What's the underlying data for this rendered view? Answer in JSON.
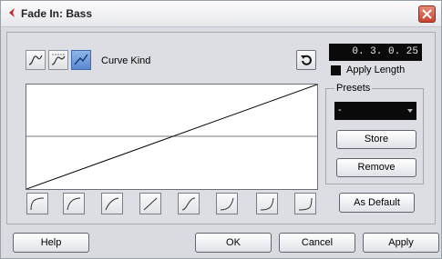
{
  "window": {
    "title": "Fade In: Bass"
  },
  "curve_kind": {
    "label": "Curve Kind",
    "options": [
      "spline-curve-icon",
      "damped-spline-curve-icon",
      "linear-curve-icon"
    ],
    "selected": "linear-curve-icon"
  },
  "length": {
    "value": "0. 3. 0. 25"
  },
  "apply_length": {
    "label": "Apply Length",
    "checked": true
  },
  "presets": {
    "title": "Presets",
    "selected": "-",
    "store_label": "Store",
    "remove_label": "Remove"
  },
  "as_default_label": "As Default",
  "shape_presets": [
    "shape-preset-1-icon",
    "shape-preset-2-icon",
    "shape-preset-3-icon",
    "shape-preset-4-icon",
    "shape-preset-5-icon",
    "shape-preset-6-icon",
    "shape-preset-7-icon",
    "shape-preset-8-icon"
  ],
  "footer": {
    "help_label": "Help",
    "ok_label": "OK",
    "cancel_label": "Cancel",
    "apply_label": "Apply"
  },
  "colors": {
    "active_kind": "#5b87d2",
    "close": "#c9432f",
    "field_bg": "#0a0a0a",
    "app_icon": "#c42020"
  }
}
